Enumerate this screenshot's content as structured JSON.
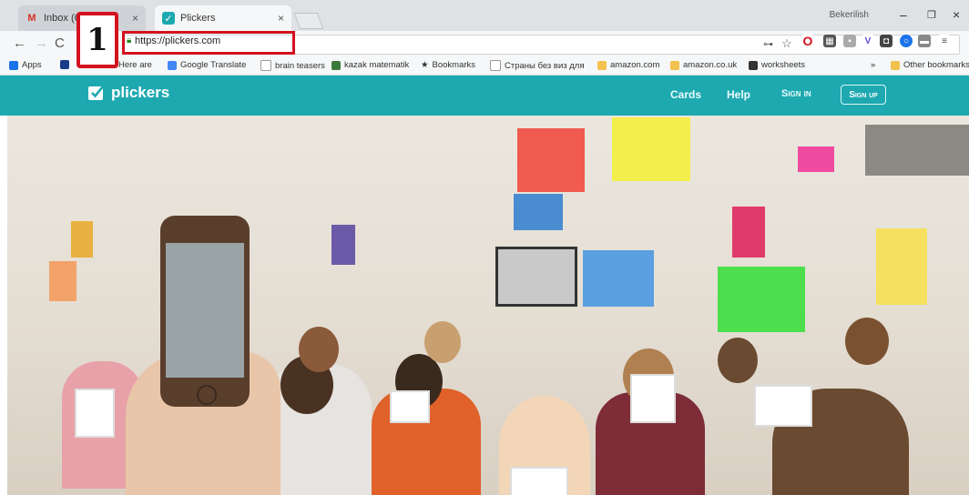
{
  "browser": {
    "tabs": [
      {
        "label": "Inbox (6)",
        "icon": "gmail-icon",
        "active": false
      },
      {
        "label": "Plickers",
        "icon": "plickers-favicon",
        "active": true
      }
    ],
    "profile_name": "Bekerilish",
    "url": "https://plickers.com",
    "bookmarks": [
      {
        "label": "Apps",
        "icon": "apps-grid-icon"
      },
      {
        "label": "Here are",
        "icon": "bookmark-icon"
      },
      {
        "label": "Google Translate",
        "icon": "translate-icon"
      },
      {
        "label": "brain teasers",
        "icon": "page-icon"
      },
      {
        "label": "kazak matematik",
        "icon": "page-icon"
      },
      {
        "label": "Bookmarks",
        "icon": "star-icon"
      },
      {
        "label": "Страны без виз для",
        "icon": "page-icon"
      },
      {
        "label": "amazon.com",
        "icon": "folder-icon"
      },
      {
        "label": "amazon.co.uk",
        "icon": "folder-icon"
      },
      {
        "label": "worksheets",
        "icon": "page-icon"
      },
      {
        "label": "»",
        "icon": ""
      },
      {
        "label": "Other bookmarks",
        "icon": "folder-icon"
      }
    ]
  },
  "annotation": {
    "step_number": "1",
    "highlight_color": "#d4111e"
  },
  "site": {
    "brand": "plickers",
    "nav": {
      "cards": "Cards",
      "help": "Help",
      "sign_in": "Sign in",
      "sign_up": "Sign up"
    },
    "accent_color": "#1ea9b0"
  }
}
